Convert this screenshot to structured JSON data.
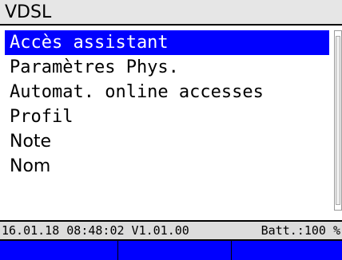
{
  "title": "VDSL",
  "menu": {
    "items": [
      {
        "label": "Accès assistant",
        "selected": true
      },
      {
        "label": "Paramètres Phys.",
        "selected": false
      },
      {
        "label": "Automat. online accesses",
        "selected": false
      },
      {
        "label": "Profil",
        "selected": false
      },
      {
        "label": "Note",
        "selected": false
      },
      {
        "label": "Nom",
        "selected": false
      }
    ]
  },
  "status": {
    "datetime_version": "16.01.18 08:48:02 V1.01.00",
    "battery": "Batt.:100 %"
  },
  "softkeys": [
    "",
    "",
    ""
  ],
  "colors": {
    "selection": "#0000ff",
    "softkey_bar": "#0000ff",
    "title_bar": "#e6e6e6",
    "status_bar": "#dcdcdc"
  }
}
